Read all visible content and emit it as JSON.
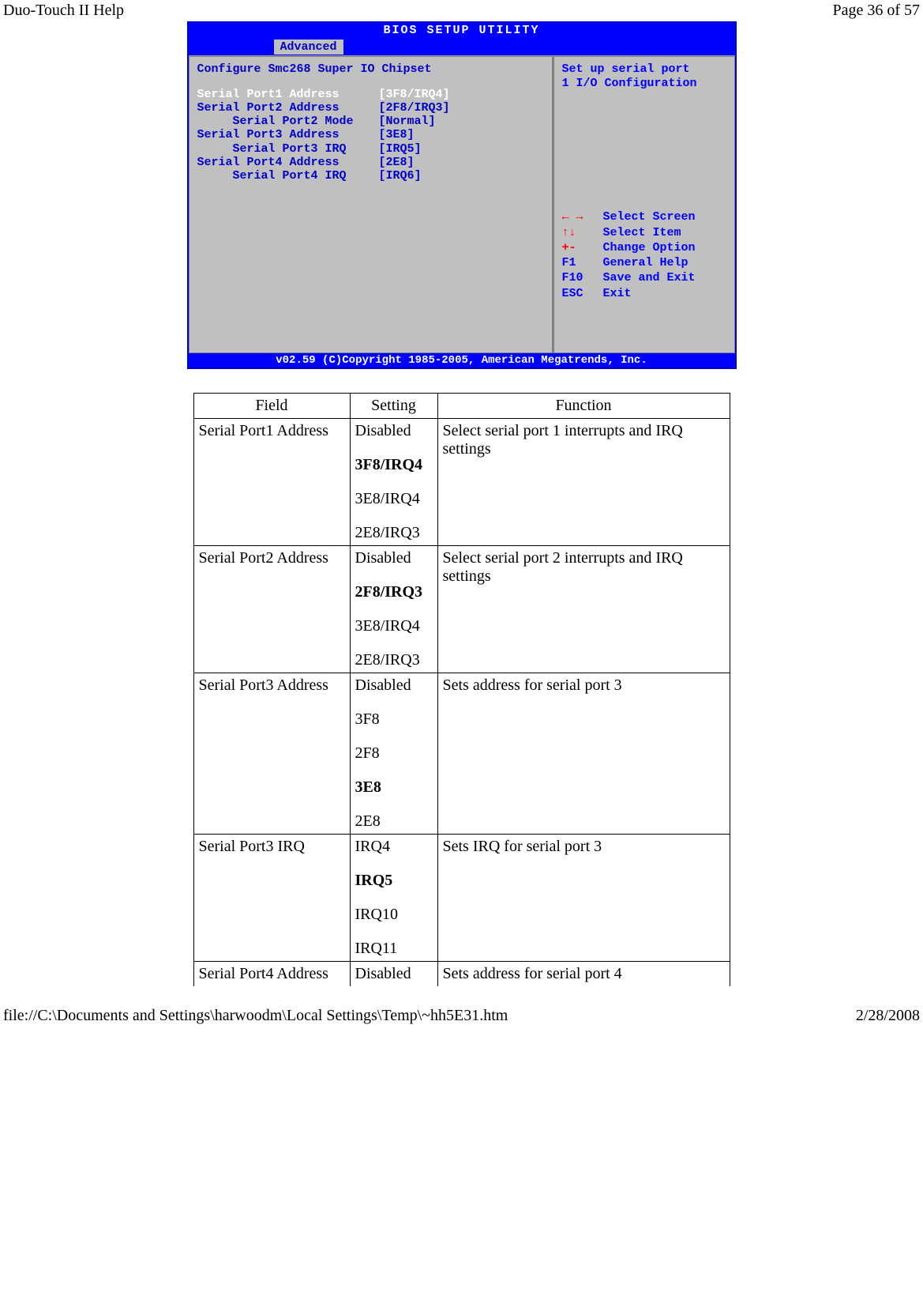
{
  "header": {
    "left": "Duo-Touch II Help",
    "right": "Page 36 of 57"
  },
  "footer": {
    "left": "file://C:\\Documents and Settings\\harwoodm\\Local Settings\\Temp\\~hh5E31.htm",
    "right": "2/28/2008"
  },
  "bios": {
    "title": "BIOS SETUP UTILITY",
    "active_tab": "Advanced",
    "config_heading": "Configure Smc268 Super IO Chipset",
    "rows": [
      {
        "label": "Serial Port1 Address",
        "value": "[3F8/IRQ4]",
        "selected": true,
        "indent": false
      },
      {
        "label": "Serial Port2 Address",
        "value": "[2F8/IRQ3]",
        "selected": false,
        "indent": false
      },
      {
        "label": "Serial Port2 Mode",
        "value": "[Normal]",
        "selected": false,
        "indent": true
      },
      {
        "label": "Serial Port3 Address",
        "value": "[3E8]",
        "selected": false,
        "indent": false
      },
      {
        "label": "Serial Port3 IRQ",
        "value": "[IRQ5]",
        "selected": false,
        "indent": true
      },
      {
        "label": "Serial Port4 Address",
        "value": "[2E8]",
        "selected": false,
        "indent": false
      },
      {
        "label": "Serial Port4 IRQ",
        "value": "[IRQ6]",
        "selected": false,
        "indent": true
      }
    ],
    "help_text_1": "Set up serial port",
    "help_text_2": "1 I/O Configuration",
    "nav": [
      {
        "key": "← →",
        "label": "Select Screen",
        "arrow": true
      },
      {
        "key": "↑↓",
        "label": "Select Item",
        "arrow": true
      },
      {
        "key": "+-",
        "label": "Change Option",
        "arrow": true
      },
      {
        "key": "F1",
        "label": "General Help",
        "arrow": false
      },
      {
        "key": "F10",
        "label": "Save and Exit",
        "arrow": false
      },
      {
        "key": "ESC",
        "label": "Exit",
        "arrow": false
      }
    ],
    "copyright": "v02.59 (C)Copyright 1985-2005, American Megatrends, Inc."
  },
  "table": {
    "headers": {
      "field": "Field",
      "setting": "Setting",
      "function": "Function"
    },
    "rows": [
      {
        "field": "Serial Port1 Address",
        "settings": [
          {
            "text": "Disabled",
            "bold": false
          },
          {
            "text": "3F8/IRQ4",
            "bold": true
          },
          {
            "text": "3E8/IRQ4",
            "bold": false
          },
          {
            "text": "2E8/IRQ3",
            "bold": false
          }
        ],
        "function": "Select serial port 1 interrupts and IRQ settings"
      },
      {
        "field": "Serial Port2 Address",
        "settings": [
          {
            "text": "Disabled",
            "bold": false
          },
          {
            "text": "2F8/IRQ3",
            "bold": true
          },
          {
            "text": "3E8/IRQ4",
            "bold": false
          },
          {
            "text": "2E8/IRQ3",
            "bold": false
          }
        ],
        "function": "Select serial port 2 interrupts and IRQ settings"
      },
      {
        "field": "Serial Port3 Address",
        "settings": [
          {
            "text": "Disabled",
            "bold": false
          },
          {
            "text": "3F8",
            "bold": false
          },
          {
            "text": "2F8",
            "bold": false
          },
          {
            "text": "3E8",
            "bold": true
          },
          {
            "text": "2E8",
            "bold": false
          }
        ],
        "function": "Sets address for serial port 3"
      },
      {
        "field": "Serial Port3 IRQ",
        "settings": [
          {
            "text": "IRQ4",
            "bold": false
          },
          {
            "text": "IRQ5",
            "bold": true
          },
          {
            "text": "IRQ10",
            "bold": false
          },
          {
            "text": "IRQ11",
            "bold": false
          }
        ],
        "function": "Sets IRQ for serial port 3"
      },
      {
        "field": "Serial Port4 Address",
        "settings": [
          {
            "text": "Disabled",
            "bold": false
          }
        ],
        "function": "Sets address for serial port 4",
        "last": true
      }
    ]
  }
}
